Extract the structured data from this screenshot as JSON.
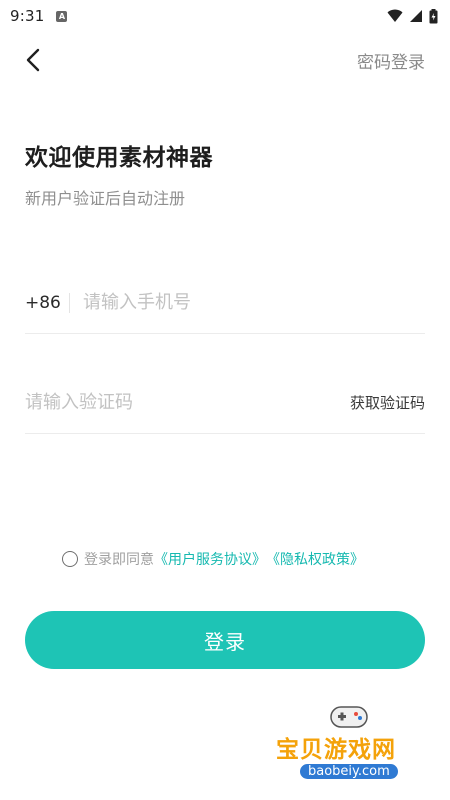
{
  "status_bar": {
    "time": "9:31",
    "app_icon_letter": "A"
  },
  "nav": {
    "password_login": "密码登录"
  },
  "welcome": {
    "title": "欢迎使用素材神器",
    "subtitle": "新用户验证后自动注册"
  },
  "phone": {
    "country_code": "+86",
    "placeholder": "请输入手机号"
  },
  "code": {
    "placeholder": "请输入验证码",
    "get_code": "获取验证码"
  },
  "agreement": {
    "prefix": "登录即同意",
    "user_agreement": "《用户服务协议》",
    "privacy_policy": "《隐私权政策》",
    "checked": false
  },
  "login_button": "登录",
  "watermark": {
    "name": "宝贝游戏网",
    "url": "baobeiy.com"
  },
  "colors": {
    "accent": "#1ec4b5",
    "link": "#16b9b0"
  }
}
